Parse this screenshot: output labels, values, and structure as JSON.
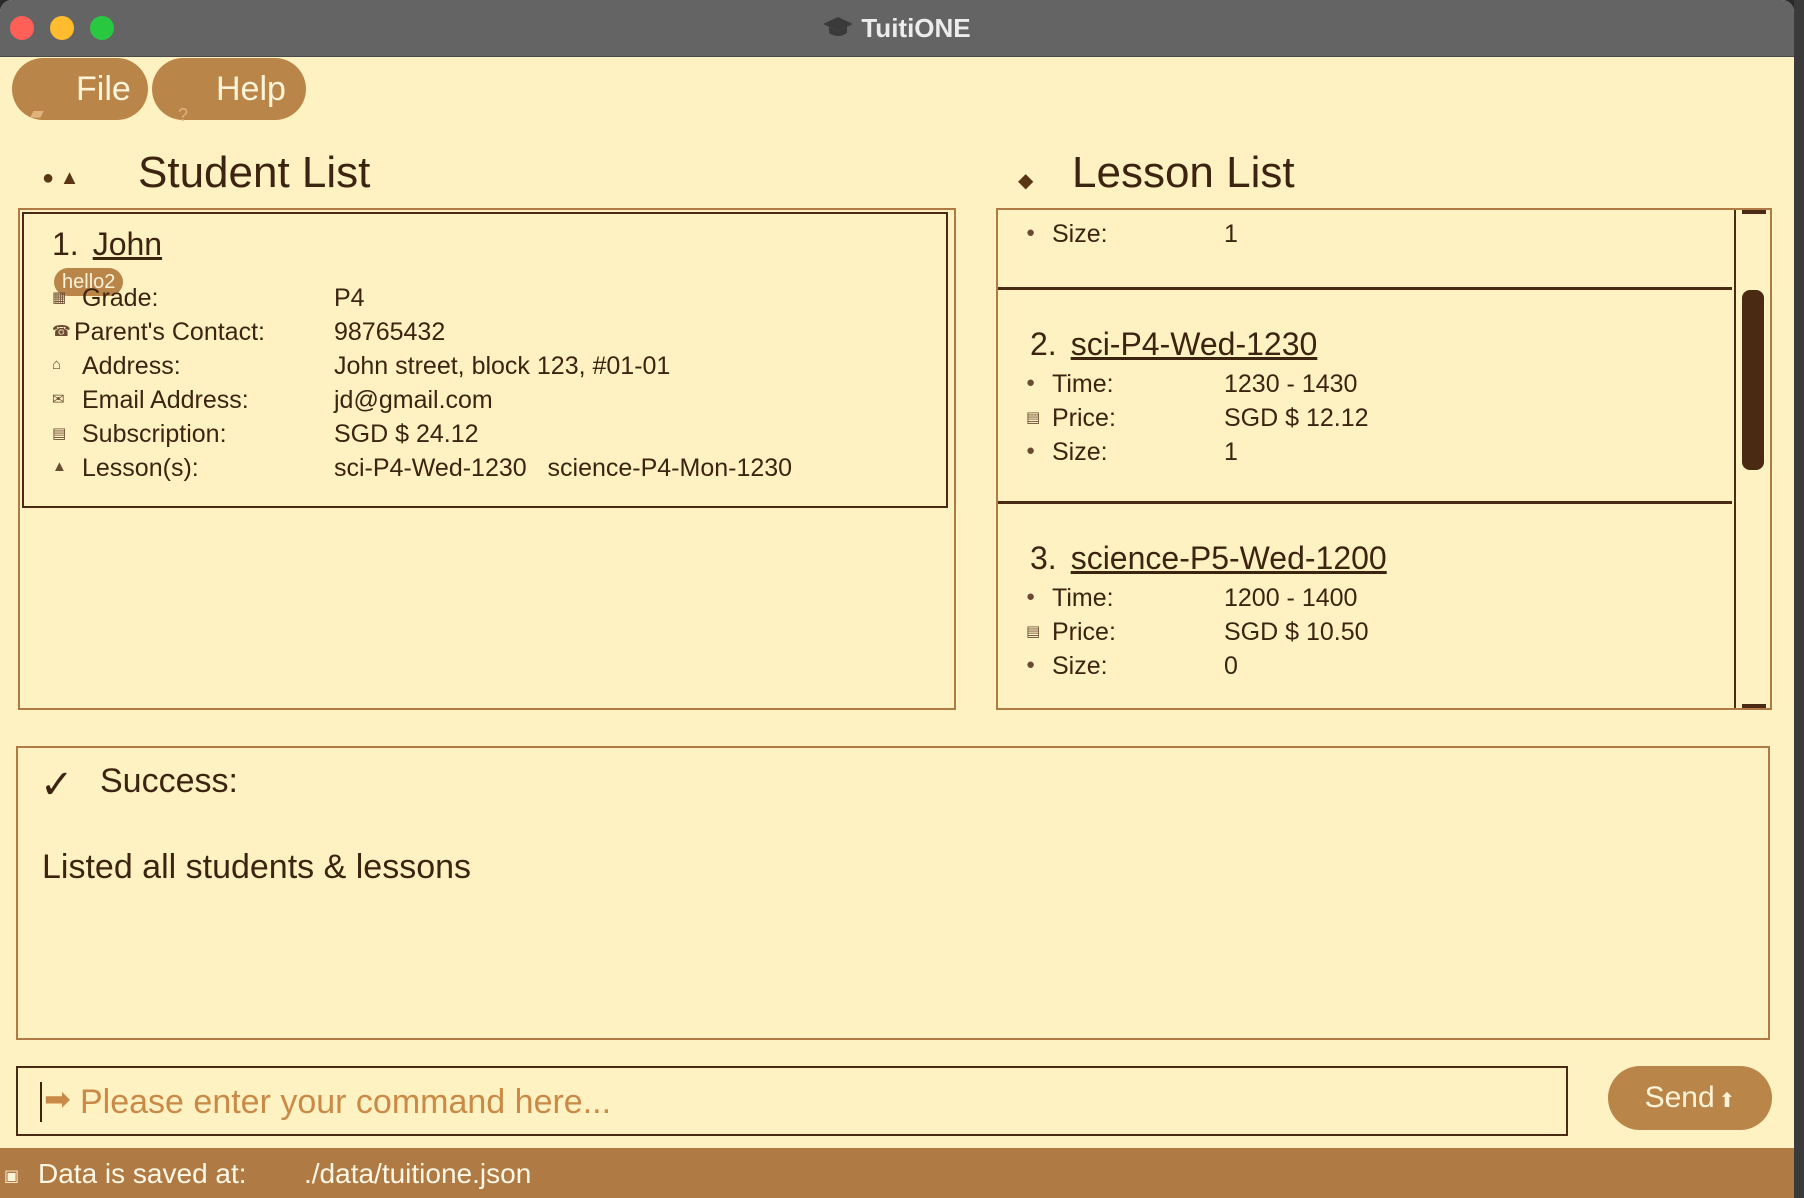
{
  "window": {
    "title": "TuitiONE"
  },
  "menu": {
    "file_label": "File",
    "help_label": "Help"
  },
  "student_list": {
    "title": "Student List",
    "students": [
      {
        "index": "1.",
        "name": "John",
        "tag": "hello2",
        "fields": [
          {
            "icon": "grade-icon",
            "label": "Grade:",
            "value": "P4"
          },
          {
            "icon": "phone-icon",
            "label": "Parent's Contact:",
            "value": "98765432"
          },
          {
            "icon": "home-icon",
            "label": "Address:",
            "value": "John street, block 123, #01-01"
          },
          {
            "icon": "email-icon",
            "label": "Email Address:",
            "value": "jd@gmail.com"
          },
          {
            "icon": "money-icon",
            "label": "Subscription:",
            "value": "SGD $ 24.12"
          },
          {
            "icon": "lesson-icon",
            "label": "Lesson(s):",
            "value": "sci-P4-Wed-1230   science-P4-Mon-1230"
          }
        ]
      }
    ]
  },
  "lesson_list": {
    "title": "Lesson List",
    "partial_card": {
      "size_label": "Size:",
      "size_value": "1"
    },
    "lessons": [
      {
        "index": "2.",
        "name": "sci-P4-Wed-1230",
        "time_label": "Time:",
        "time": "1230 - 1430",
        "price_label": "Price:",
        "price": "SGD $ 12.12",
        "size_label": "Size:",
        "size": "1"
      },
      {
        "index": "3.",
        "name": "science-P5-Wed-1200",
        "time_label": "Time:",
        "time": "1200 - 1400",
        "price_label": "Price:",
        "price": "SGD $ 10.50",
        "size_label": "Size:",
        "size": "0"
      }
    ]
  },
  "result": {
    "heading": "Success:",
    "message": "Listed all students & lessons"
  },
  "command": {
    "placeholder": "Please enter your command here...",
    "value": "",
    "send_label": "Send"
  },
  "status": {
    "label": "Data is saved at:",
    "path": "./data/tuitione.json"
  },
  "colors": {
    "background": "#fff2c2",
    "accent": "#b98549",
    "text": "#3c2410",
    "status_bar": "#b07a44"
  }
}
